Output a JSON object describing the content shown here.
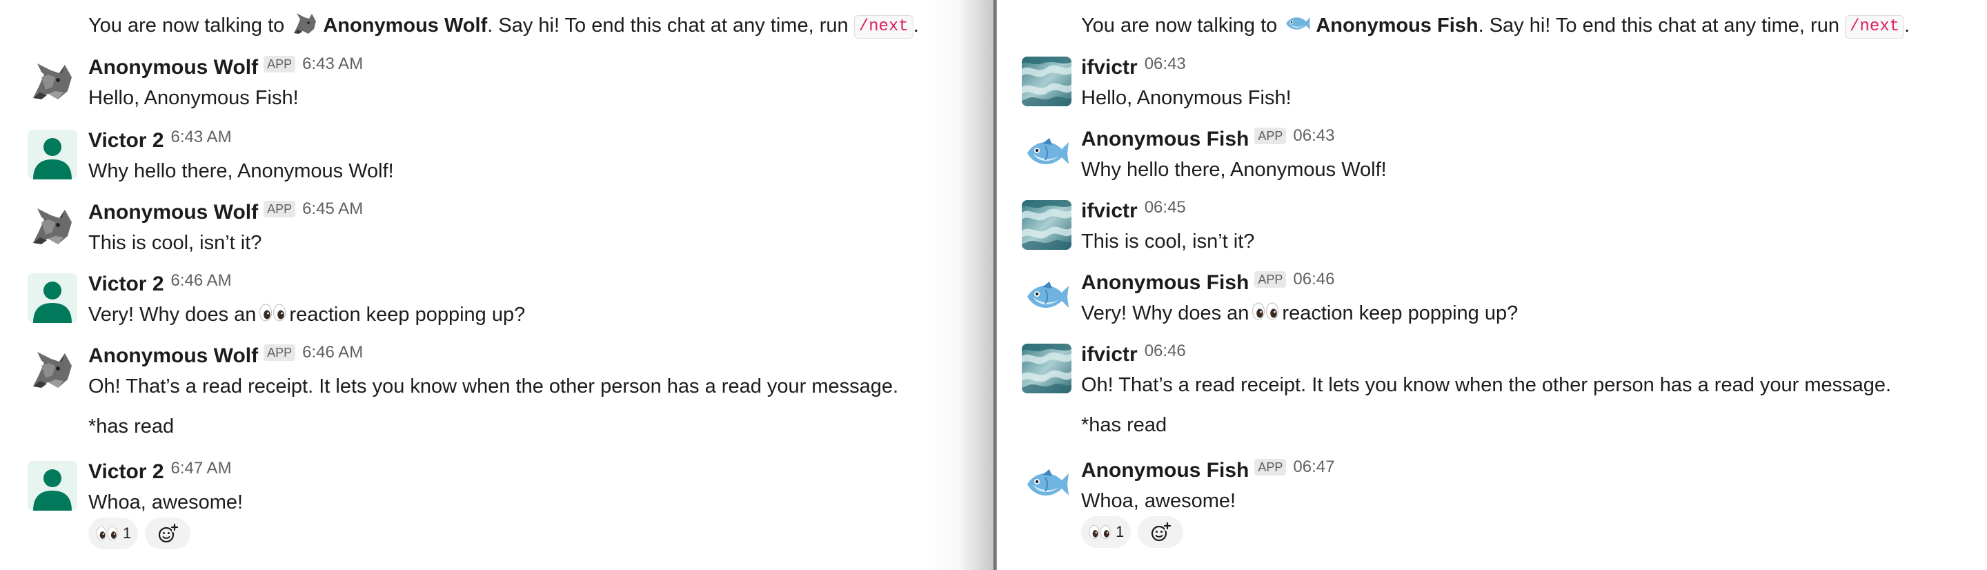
{
  "left_pane": {
    "intro": {
      "prefix": "You are now talking to",
      "name": "Anonymous Wolf",
      "suffix": ". Say hi! To end this chat at any time, run",
      "command": "/next",
      "end": "."
    },
    "messages": [
      {
        "author": "Anonymous Wolf",
        "badge": "APP",
        "time": "6:43 AM",
        "text": "Hello, Anonymous Fish!",
        "avatar": "wolf-icon"
      },
      {
        "author": "Victor 2",
        "badge": "",
        "time": "6:43 AM",
        "text": "Why hello there, Anonymous Wolf!",
        "avatar": "person-icon"
      },
      {
        "author": "Anonymous Wolf",
        "badge": "APP",
        "time": "6:45 AM",
        "text": "This is cool, isn’t it?",
        "avatar": "wolf-icon"
      },
      {
        "author": "Victor 2",
        "badge": "",
        "time": "6:46 AM",
        "text_before": "Very! Why does an",
        "text_after": "reaction keep popping up?",
        "avatar": "person-icon"
      },
      {
        "author": "Anonymous Wolf",
        "badge": "APP",
        "time": "6:46 AM",
        "text": "Oh! That’s a read receipt. It lets you know when the other person has a read your message.",
        "followup": "*has read",
        "avatar": "wolf-icon"
      },
      {
        "author": "Victor 2",
        "badge": "",
        "time": "6:47 AM",
        "text": "Whoa, awesome!",
        "avatar": "person-icon"
      }
    ],
    "reaction": {
      "emoji": "eyes-icon",
      "count": "1"
    }
  },
  "right_pane": {
    "intro": {
      "prefix": "You are now talking to",
      "name": "Anonymous Fish",
      "suffix": ". Say hi! To end this chat at any time, run",
      "command": "/next",
      "end": "."
    },
    "messages": [
      {
        "author": "ifvictr",
        "badge": "",
        "time": "06:43",
        "text": "Hello, Anonymous Fish!",
        "avatar": "ocean-photo-avatar"
      },
      {
        "author": "Anonymous Fish",
        "badge": "APP",
        "time": "06:43",
        "text": "Why hello there, Anonymous Wolf!",
        "avatar": "fish-icon"
      },
      {
        "author": "ifvictr",
        "badge": "",
        "time": "06:45",
        "text": "This is cool, isn’t it?",
        "avatar": "ocean-photo-avatar"
      },
      {
        "author": "Anonymous Fish",
        "badge": "APP",
        "time": "06:46",
        "text_before": "Very! Why does an",
        "text_after": "reaction keep popping up?",
        "avatar": "fish-icon"
      },
      {
        "author": "ifvictr",
        "badge": "",
        "time": "06:46",
        "text": "Oh! That’s a read receipt. It lets you know when the other person has a read your message.",
        "followup": "*has read",
        "avatar": "ocean-photo-avatar"
      },
      {
        "author": "Anonymous Fish",
        "badge": "APP",
        "time": "06:47",
        "text": "Whoa, awesome!",
        "avatar": "fish-icon"
      }
    ],
    "reaction": {
      "emoji": "eyes-icon",
      "count": "1"
    }
  },
  "colors": {
    "person_avatar": "#007a5a",
    "command_text": "#e01e5a",
    "timestamp": "#616061"
  }
}
